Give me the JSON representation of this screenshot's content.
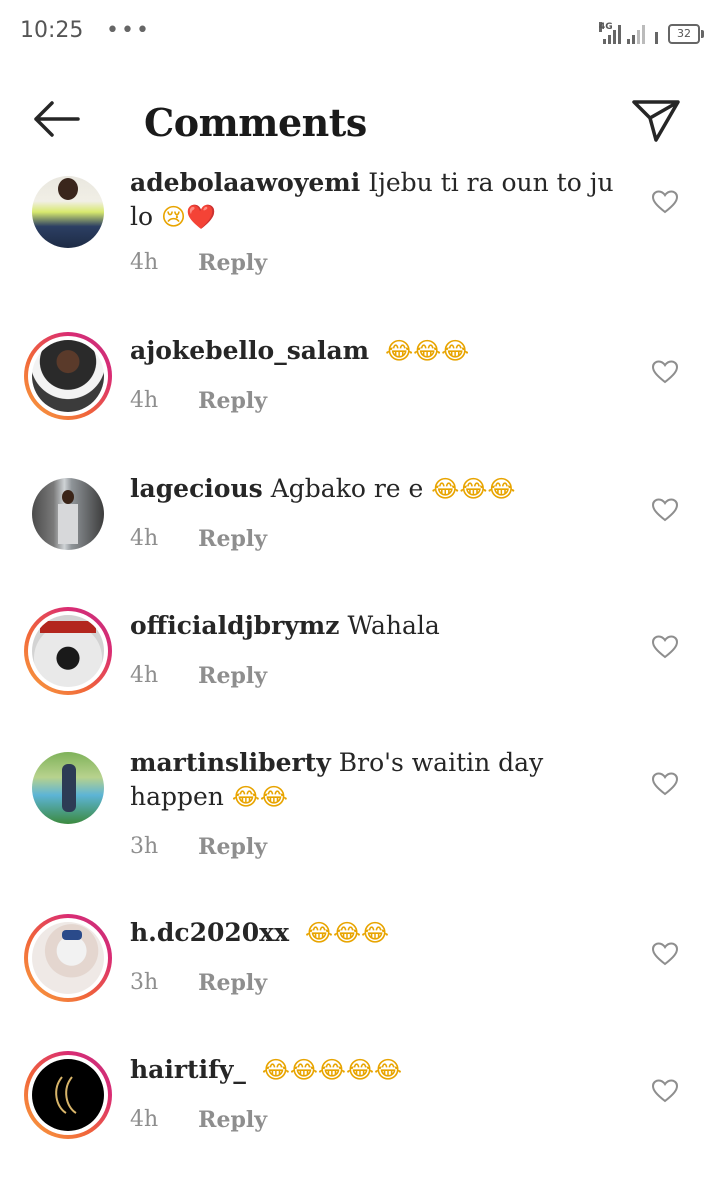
{
  "status": {
    "time": "10:25",
    "dots": "•••",
    "network": "4G",
    "battery": "32"
  },
  "header": {
    "title": "Comments"
  },
  "comments": [
    {
      "username": "adebolaawoyemi",
      "text": "Ijebu ti ra oun to ju lo",
      "emoji": "😢❤️",
      "time": "4h",
      "reply": "Reply"
    },
    {
      "username": "ajokebello_salam",
      "text": "",
      "emoji": "😂😂😂",
      "time": "4h",
      "reply": "Reply"
    },
    {
      "username": "lagecious",
      "text": "Agbako re e",
      "emoji": "😂😂😂",
      "time": "4h",
      "reply": "Reply"
    },
    {
      "username": "officialdjbrymz",
      "text": "Wahala",
      "emoji": "",
      "time": "4h",
      "reply": "Reply"
    },
    {
      "username": "martinsliberty",
      "text": "Bro's waitin day happen",
      "emoji": "😂😂",
      "time": "3h",
      "reply": "Reply"
    },
    {
      "username": "h.dc2020xx",
      "text": "",
      "emoji": "😂😂😂",
      "time": "3h",
      "reply": "Reply"
    },
    {
      "username": "hairtify_",
      "text": "",
      "emoji": "😂😂😂😂😂",
      "time": "4h",
      "reply": "Reply"
    }
  ],
  "icons": {
    "back": "arrow-left-icon",
    "send": "paper-plane-icon",
    "like": "heart-outline-icon"
  },
  "colors": {
    "story_ring_start": "#f9a33f",
    "story_ring_end": "#c1357d",
    "meta_gray": "#8e8e8e"
  }
}
